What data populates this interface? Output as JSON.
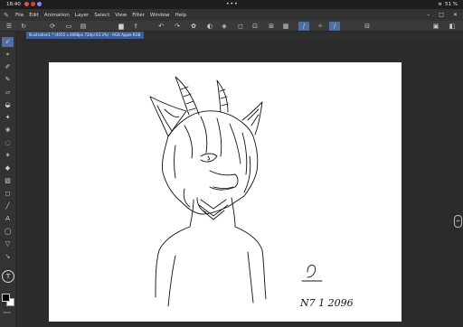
{
  "status_bar": {
    "time": "18:40",
    "dots": "•••",
    "battery": "51 %",
    "notification_colors": [
      "#e05050",
      "#d04040",
      "#8a8aff"
    ]
  },
  "menu": {
    "items": [
      "File",
      "Edit",
      "Animation",
      "Layer",
      "Select",
      "View",
      "Filter",
      "Window",
      "Help"
    ]
  },
  "toolbar": {
    "icons": [
      "menu-icon",
      "refresh-icon",
      "brush-settings-icon",
      "new-file-icon",
      "open-file-icon",
      "save-icon",
      "export-icon",
      "undo-icon",
      "redo-icon",
      "gear-icon",
      "fill-icon",
      "layer-icon",
      "transform-icon",
      "clear-icon",
      "ruler-icon",
      "selection-icon",
      "flip-icon",
      "grid-icon",
      "snap-icon",
      "pen-pressure-icon",
      "active-pen-icon",
      "edit-mode-icon",
      "settings-icon"
    ],
    "active_indices": [
      18,
      20
    ]
  },
  "document_tab": {
    "label": "Illustration1 * (4055 x 4068px 72dpi 63.3%) - RGB Apple RGB"
  },
  "left_tools": {
    "icons": [
      "move-icon",
      "select-icon",
      "eyedropper-icon",
      "pen-icon",
      "eraser-icon",
      "blend-icon",
      "airbrush-icon",
      "decoration-icon",
      "lasso-icon",
      "magic-wand-icon",
      "fill-bucket-icon",
      "gradient-icon",
      "figure-icon",
      "line-icon",
      "text-icon",
      "balloon-icon",
      "frame-icon",
      "correct-line-icon",
      "operation-icon",
      "reference-icon"
    ],
    "active_index": 0,
    "undo_badge": "T"
  },
  "colors": {
    "accent": "#4d6fa3",
    "foreground": "#000000",
    "background": "#ffffff"
  },
  "canvas": {
    "signature_text": "N7 1 2096"
  }
}
